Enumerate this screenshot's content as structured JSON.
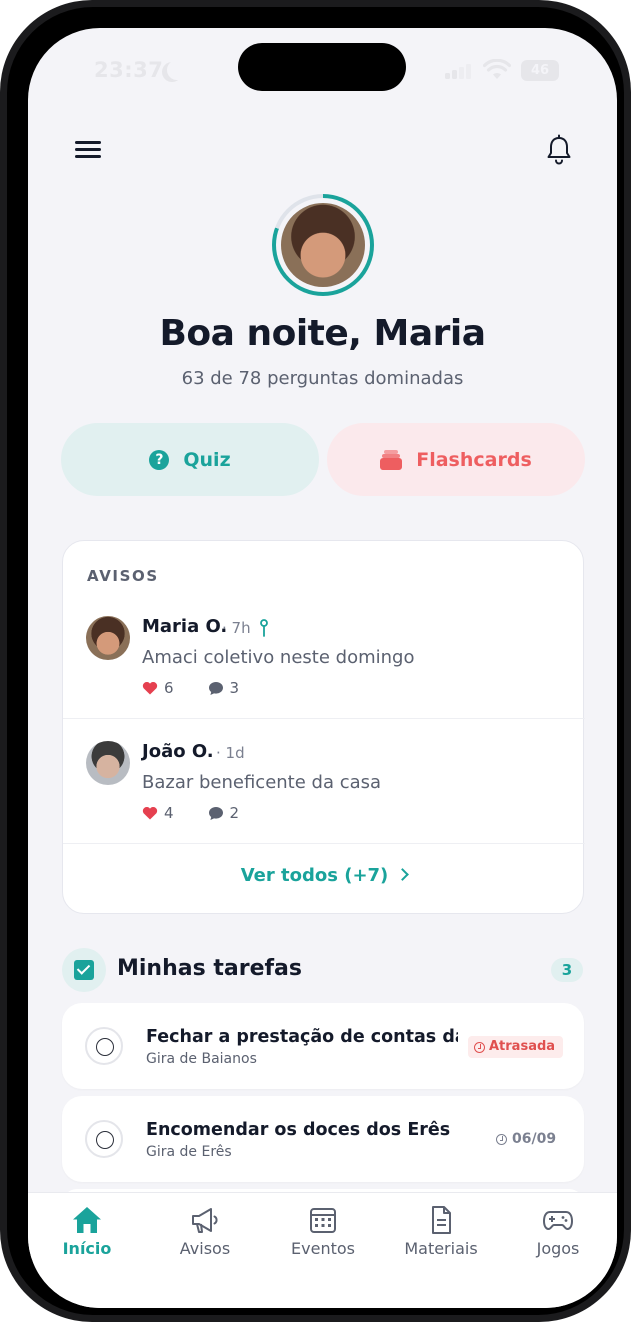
{
  "status_bar": {
    "time": "23:37",
    "battery": "46"
  },
  "header": {
    "greeting": "Boa noite, Maria",
    "progress": "63 de 78 perguntas dominadas",
    "progress_value": {
      "mastered": 63,
      "total": 78
    }
  },
  "actions": {
    "quiz_label": "Quiz",
    "flashcards_label": "Flashcards"
  },
  "avisos": {
    "title": "AVISOS",
    "posts": [
      {
        "author": "Maria O.",
        "time": "· 7h",
        "pinned": true,
        "text": "Amaci coletivo neste domingo",
        "likes": "6",
        "comments": "3"
      },
      {
        "author": "João O.",
        "time": "· 1d",
        "pinned": false,
        "text": "Bazar beneficente da casa",
        "likes": "4",
        "comments": "2"
      }
    ],
    "see_all": "Ver todos (+7)"
  },
  "tasks": {
    "title": "Minhas tarefas",
    "count": "3",
    "items": [
      {
        "title": "Fechar a prestação de contas da...",
        "subtitle": "Gira de Baianos",
        "badge": "Atrasada"
      },
      {
        "title": "Encomendar os doces dos Erês",
        "subtitle": "Gira de Erês",
        "date": "06/09"
      }
    ]
  },
  "tabbar": {
    "items": [
      {
        "label": "Início",
        "icon": "home-icon",
        "active": true
      },
      {
        "label": "Avisos",
        "icon": "megaphone-icon"
      },
      {
        "label": "Eventos",
        "icon": "calendar-icon"
      },
      {
        "label": "Materiais",
        "icon": "document-icon"
      },
      {
        "label": "Jogos",
        "icon": "gamepad-icon"
      }
    ]
  },
  "colors": {
    "accent": "#1aa39b",
    "flashcards": "#ee5e60",
    "background": "#f4f4f8",
    "text": "#141a2a"
  }
}
